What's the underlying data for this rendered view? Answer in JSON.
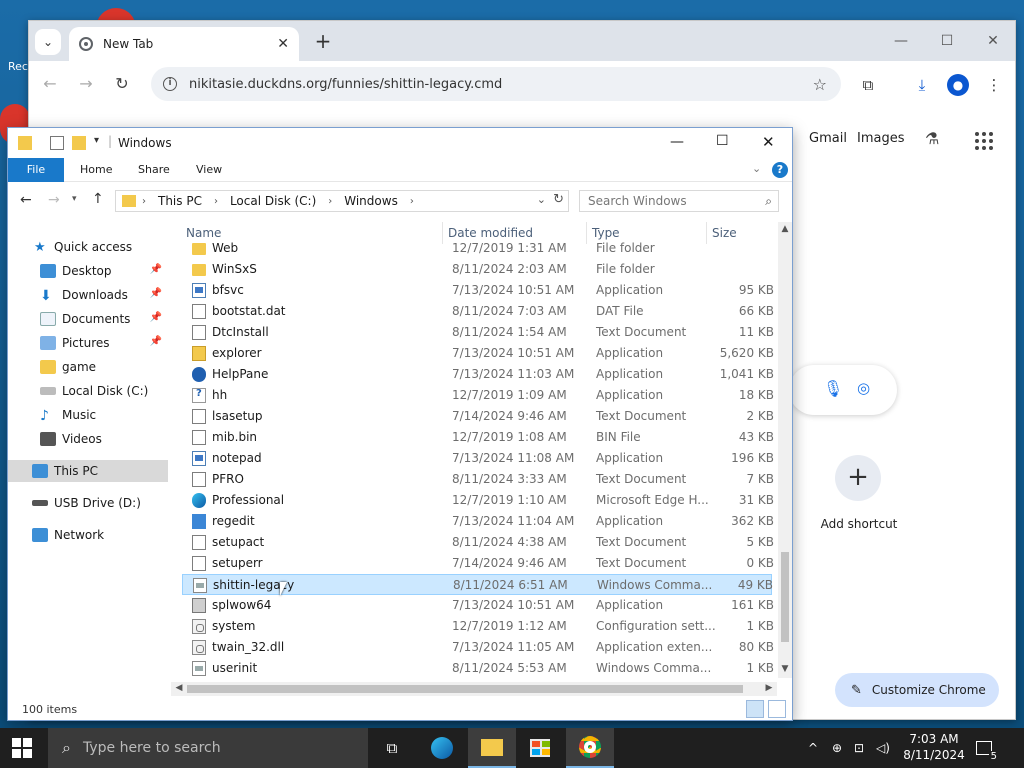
{
  "desktop": {
    "recycle_label": "Rec"
  },
  "chrome": {
    "tab_title": "New Tab",
    "tab_close": "✕",
    "new_tab": "+",
    "url": "nikitasie.duckdns.org/funnies/shittin-legacy.cmd",
    "gmail": "Gmail",
    "images": "Images",
    "add_shortcut": "Add shortcut",
    "customize": "Customize Chrome"
  },
  "explorer": {
    "title": "Windows",
    "ribbon_tabs": [
      "File",
      "Home",
      "Share",
      "View"
    ],
    "breadcrumb": [
      "This PC",
      "Local Disk (C:)",
      "Windows"
    ],
    "search_placeholder": "Search Windows",
    "nav": {
      "quick_access": "Quick access",
      "desktop": "Desktop",
      "downloads": "Downloads",
      "documents": "Documents",
      "pictures": "Pictures",
      "game": "game",
      "local_disk": "Local Disk (C:)",
      "music": "Music",
      "videos": "Videos",
      "this_pc": "This PC",
      "usb": "USB Drive (D:)",
      "network": "Network"
    },
    "columns": {
      "name": "Name",
      "date": "Date modified",
      "type": "Type",
      "size": "Size"
    },
    "rows": [
      {
        "name": "Web",
        "date": "12/7/2019 1:31 AM",
        "type": "File folder",
        "size": "",
        "icon": "folder"
      },
      {
        "name": "WinSxS",
        "date": "8/11/2024 2:03 AM",
        "type": "File folder",
        "size": "",
        "icon": "folder"
      },
      {
        "name": "bfsvc",
        "date": "7/13/2024 10:51 AM",
        "type": "Application",
        "size": "95 KB",
        "icon": "app"
      },
      {
        "name": "bootstat.dat",
        "date": "8/11/2024 7:03 AM",
        "type": "DAT File",
        "size": "66 KB",
        "icon": "file"
      },
      {
        "name": "DtcInstall",
        "date": "8/11/2024 1:54 AM",
        "type": "Text Document",
        "size": "11 KB",
        "icon": "file"
      },
      {
        "name": "explorer",
        "date": "7/13/2024 10:51 AM",
        "type": "Application",
        "size": "5,620 KB",
        "icon": "folderapp"
      },
      {
        "name": "HelpPane",
        "date": "7/13/2024 11:03 AM",
        "type": "Application",
        "size": "1,041 KB",
        "icon": "help"
      },
      {
        "name": "hh",
        "date": "12/7/2019 1:09 AM",
        "type": "Application",
        "size": "18 KB",
        "icon": "hh"
      },
      {
        "name": "lsasetup",
        "date": "7/14/2024 9:46 AM",
        "type": "Text Document",
        "size": "2 KB",
        "icon": "file"
      },
      {
        "name": "mib.bin",
        "date": "12/7/2019 1:08 AM",
        "type": "BIN File",
        "size": "43 KB",
        "icon": "file"
      },
      {
        "name": "notepad",
        "date": "7/13/2024 11:08 AM",
        "type": "Application",
        "size": "196 KB",
        "icon": "app"
      },
      {
        "name": "PFRO",
        "date": "8/11/2024 3:33 AM",
        "type": "Text Document",
        "size": "7 KB",
        "icon": "file"
      },
      {
        "name": "Professional",
        "date": "12/7/2019 1:10 AM",
        "type": "Microsoft Edge H...",
        "size": "31 KB",
        "icon": "edge"
      },
      {
        "name": "regedit",
        "date": "7/13/2024 11:04 AM",
        "type": "Application",
        "size": "362 KB",
        "icon": "reg"
      },
      {
        "name": "setupact",
        "date": "8/11/2024 4:38 AM",
        "type": "Text Document",
        "size": "5 KB",
        "icon": "file"
      },
      {
        "name": "setuperr",
        "date": "7/14/2024 9:46 AM",
        "type": "Text Document",
        "size": "0 KB",
        "icon": "file"
      },
      {
        "name": "shittin-legacy",
        "date": "8/11/2024 6:51 AM",
        "type": "Windows Comma...",
        "size": "49 KB",
        "icon": "cmd",
        "selected": true
      },
      {
        "name": "splwow64",
        "date": "7/13/2024 10:51 AM",
        "type": "Application",
        "size": "161 KB",
        "icon": "print"
      },
      {
        "name": "system",
        "date": "12/7/2019 1:12 AM",
        "type": "Configuration sett...",
        "size": "1 KB",
        "icon": "conf"
      },
      {
        "name": "twain_32.dll",
        "date": "7/13/2024 11:05 AM",
        "type": "Application exten...",
        "size": "80 KB",
        "icon": "conf"
      },
      {
        "name": "userinit",
        "date": "8/11/2024 5:53 AM",
        "type": "Windows Comma...",
        "size": "1 KB",
        "icon": "cmd"
      }
    ],
    "status": "100 items"
  },
  "taskbar": {
    "search_placeholder": "Type here to search",
    "time": "7:03 AM",
    "date": "8/11/2024",
    "notif_count": "5"
  }
}
